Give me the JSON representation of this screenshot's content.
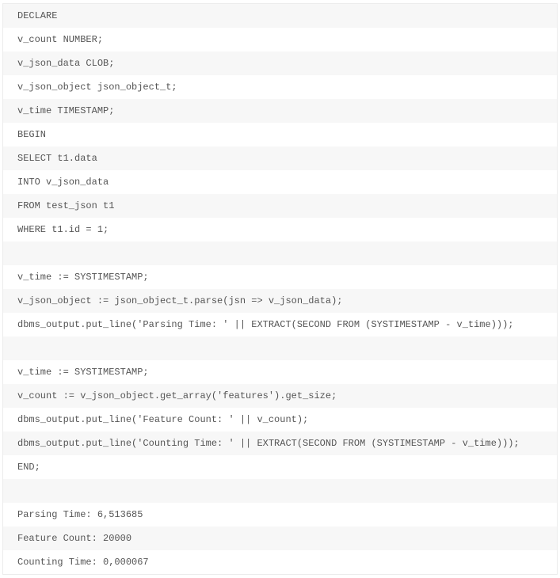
{
  "lines": [
    "DECLARE",
    "v_count NUMBER;",
    "v_json_data CLOB;",
    "v_json_object json_object_t;",
    "v_time TIMESTAMP;",
    "BEGIN",
    "SELECT t1.data",
    "INTO v_json_data",
    "FROM test_json t1",
    "WHERE t1.id = 1;",
    "",
    "v_time := SYSTIMESTAMP;",
    "v_json_object := json_object_t.parse(jsn => v_json_data);",
    "dbms_output.put_line('Parsing Time: ' || EXTRACT(SECOND FROM (SYSTIMESTAMP - v_time)));",
    "",
    "v_time := SYSTIMESTAMP;",
    "v_count := v_json_object.get_array('features').get_size;",
    "dbms_output.put_line('Feature Count: ' || v_count);",
    "dbms_output.put_line('Counting Time: ' || EXTRACT(SECOND FROM (SYSTIMESTAMP - v_time)));",
    "END;",
    "",
    "Parsing Time: 6,513685",
    "Feature Count: 20000",
    "Counting Time: 0,000067"
  ]
}
